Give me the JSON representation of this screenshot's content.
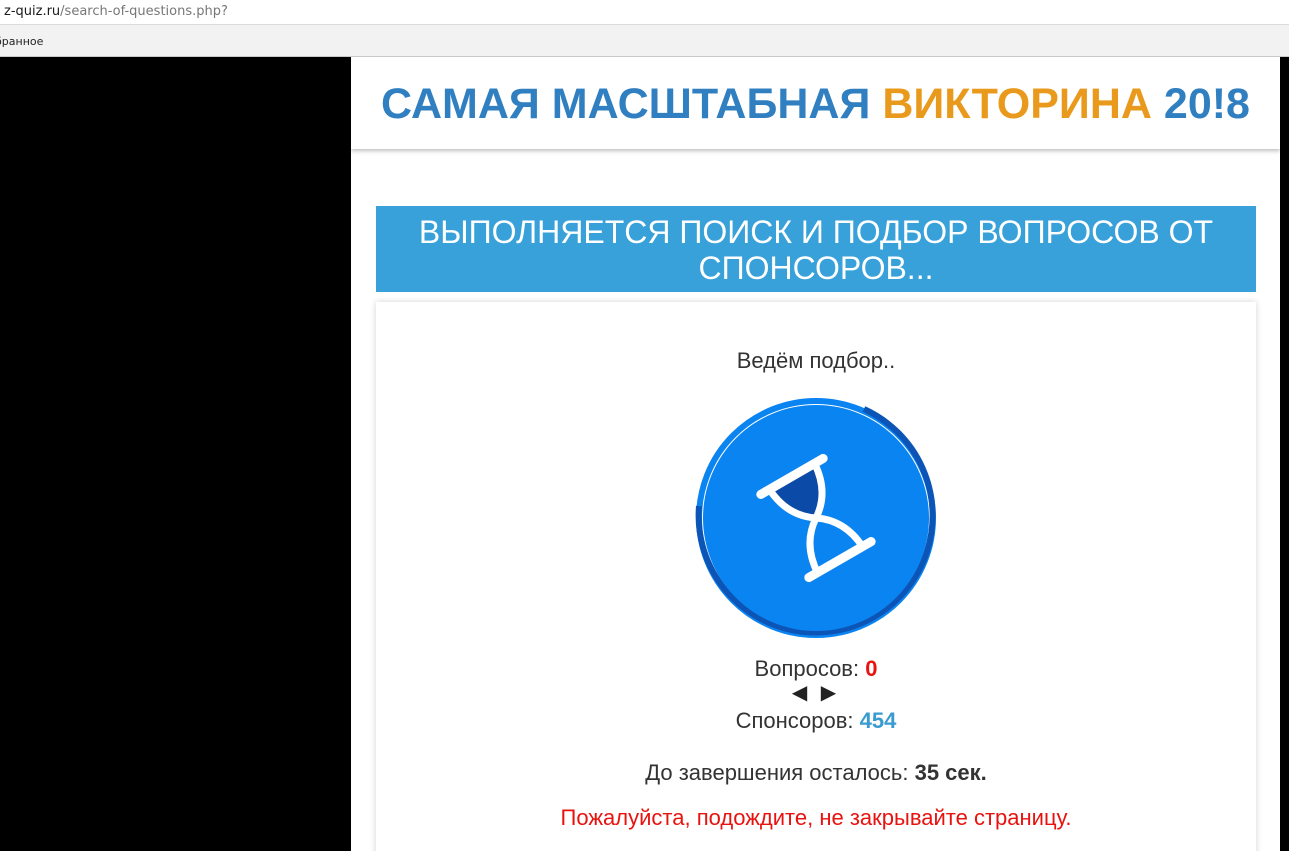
{
  "browser": {
    "url_domain": "z-quiz.ru",
    "url_path": "/search-of-questions.php?",
    "bookmark_label": "бранное"
  },
  "header": {
    "title_part1": "САМАЯ МАСШТАБНАЯ ",
    "title_accent": "ВИКТОРИНА",
    "title_part2": " 20!8"
  },
  "banner": {
    "text": "ВЫПОЛНЯЕТСЯ ПОИСК И ПОДБОР ВОПРОСОВ ОТ СПОНСОРОВ..."
  },
  "card": {
    "status": "Ведём подбор..",
    "loader_icon": "hourglass-icon",
    "questions_label": "Вопросов: ",
    "questions_count": "0",
    "arrows": "◀ ▶",
    "sponsors_label": "Спонсоров: ",
    "sponsors_count": "454",
    "timer_label": "До завершения осталось: ",
    "timer_value": "35 сек.",
    "notice": "Пожалуйста, подождите, не закрывайте страницу."
  },
  "colors": {
    "title_blue": "#2f7fc1",
    "title_orange": "#e99a1c",
    "banner_bg": "#38a1d9",
    "circle": "#0a84f0",
    "ring": "#0c55b6",
    "alert_red": "#e8130f",
    "count_blue": "#3a9bd0"
  }
}
